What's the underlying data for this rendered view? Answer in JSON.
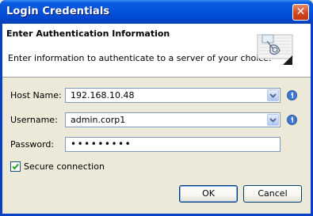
{
  "window": {
    "title": "Login Credentials",
    "close_glyph": "✕"
  },
  "banner": {
    "heading": "Enter Authentication Information",
    "description": "Enter information to authenticate to a server of your choice.",
    "icon": "network-login-icon"
  },
  "form": {
    "host": {
      "label": "Host Name:",
      "value": "192.168.10.48",
      "info_icon": "info-icon"
    },
    "username": {
      "label": "Username:",
      "value": "admin.corp1",
      "info_icon": "info-icon"
    },
    "password": {
      "label": "Password:",
      "value": "•••••••••"
    },
    "secure": {
      "label": "Secure connection",
      "checked": true
    }
  },
  "buttons": {
    "ok": "OK",
    "cancel": "Cancel"
  },
  "colors": {
    "accent": "#0a3ea8",
    "field_border": "#7f9db9",
    "info_blue": "#3d77cf"
  }
}
